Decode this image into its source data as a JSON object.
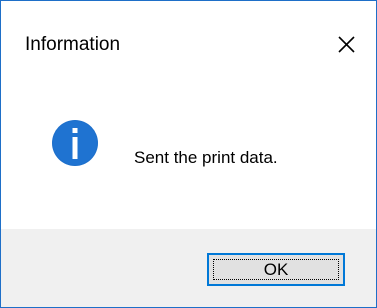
{
  "window": {
    "title": "Information",
    "close_icon": "close-icon"
  },
  "content": {
    "icon": "info-icon",
    "message": "Sent the print data."
  },
  "footer": {
    "ok_label": "OK"
  },
  "colors": {
    "border": "#1e6fc8",
    "info_icon_fill": "#1d6fcb",
    "footer_bg": "#f0f0f0",
    "button_bg": "#e1e1e1",
    "button_border": "#0078d7"
  }
}
